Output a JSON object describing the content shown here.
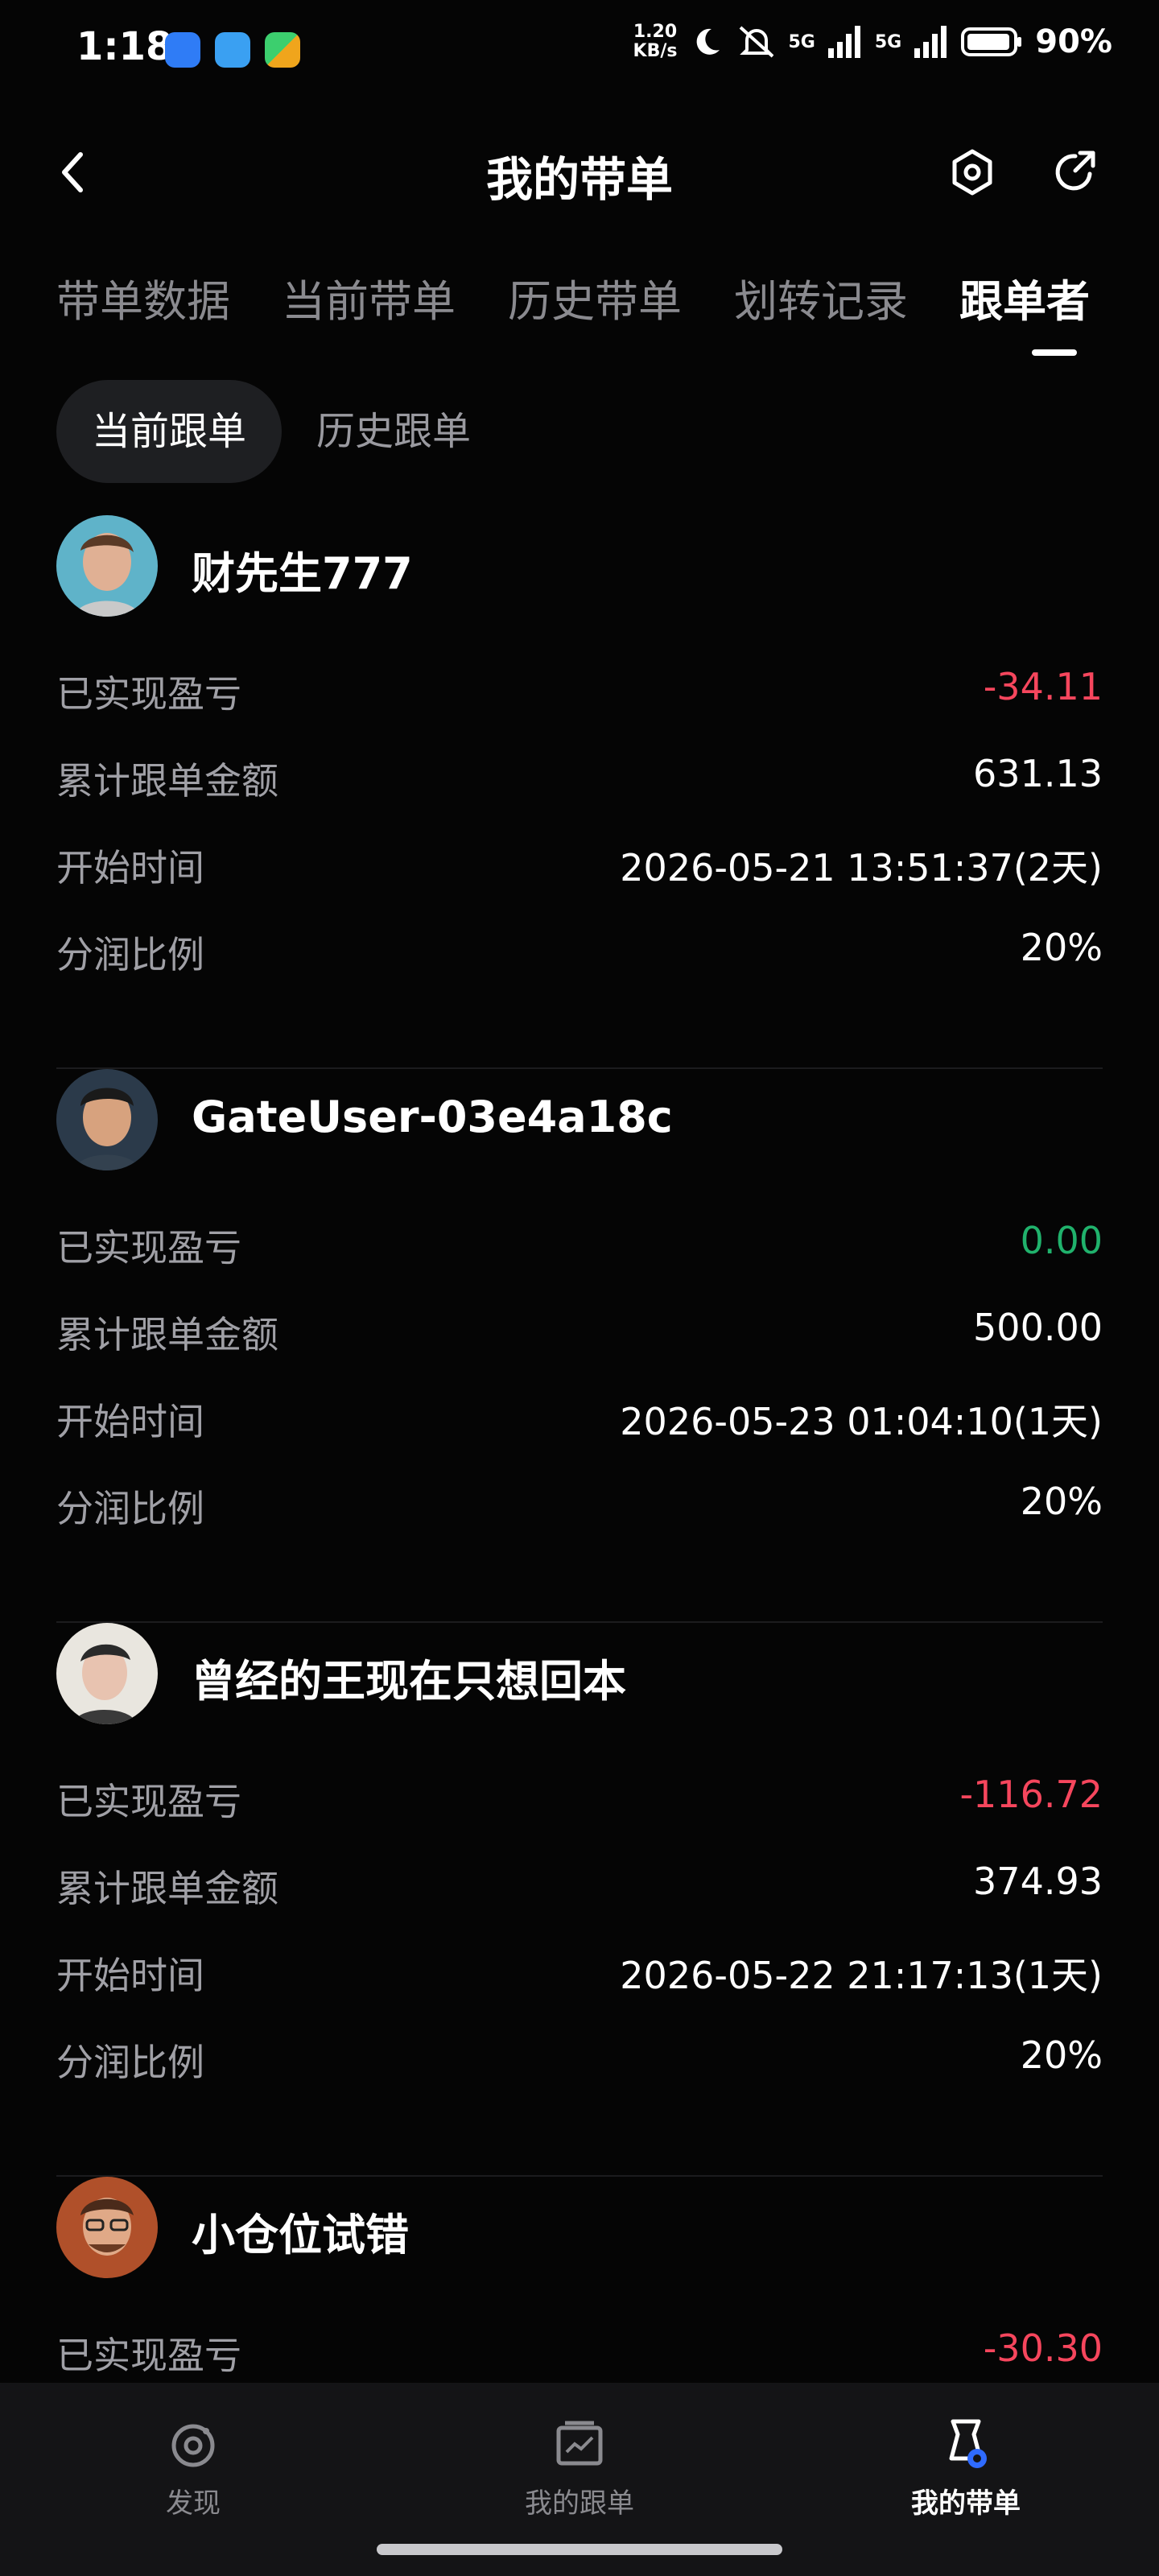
{
  "status_bar": {
    "time": "1:18",
    "speed_value": "1.20",
    "speed_unit": "KB/s",
    "sig1": "5G",
    "sig2": "5G",
    "battery": "90%"
  },
  "header": {
    "title": "我的带单"
  },
  "tabs": [
    "带单数据",
    "当前带单",
    "历史带单",
    "划转记录",
    "跟单者"
  ],
  "segments": [
    "当前跟单",
    "历史跟单"
  ],
  "labels": {
    "pnl": "已实现盈亏",
    "amount": "累计跟单金额",
    "start": "开始时间",
    "share": "分润比例"
  },
  "followers": [
    {
      "name": "财先生777",
      "pnl": "-34.11",
      "pnl_status": "negative",
      "amount": "631.13",
      "start": "2026-05-21 13:51:37(2天)",
      "share": "20%"
    },
    {
      "name": "GateUser-03e4a18c",
      "pnl": "0.00",
      "pnl_status": "zero",
      "amount": "500.00",
      "start": "2026-05-23 01:04:10(1天)",
      "share": "20%"
    },
    {
      "name": "曾经的王现在只想回本",
      "pnl": "-116.72",
      "pnl_status": "negative",
      "amount": "374.93",
      "start": "2026-05-22 21:17:13(1天)",
      "share": "20%"
    },
    {
      "name": "小仓位试错",
      "pnl": "-30.30",
      "pnl_status": "negative"
    }
  ],
  "bottom_nav": [
    {
      "label": "发现",
      "icon": "discover-icon"
    },
    {
      "label": "我的跟单",
      "icon": "chart-folder-icon"
    },
    {
      "label": "我的带单",
      "icon": "flag-badge-icon"
    }
  ],
  "colors": {
    "background": "#050505",
    "negative": "#f6465d",
    "zero": "#20b26c",
    "accent": "#2f6bff"
  }
}
